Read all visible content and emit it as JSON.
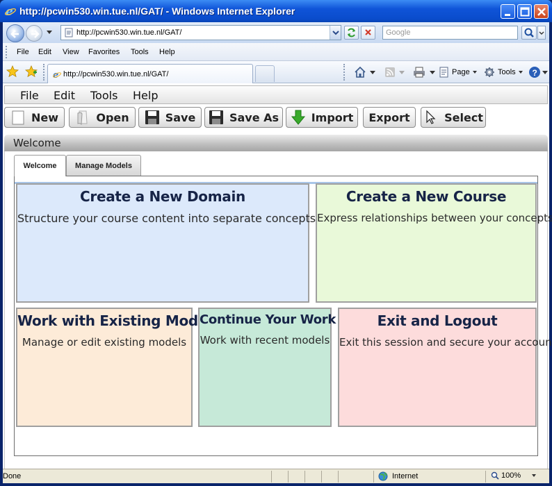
{
  "window": {
    "title": "http://pcwin530.win.tue.nl/GAT/ - Windows Internet Explorer"
  },
  "browser": {
    "address": "http://pcwin530.win.tue.nl/GAT/",
    "search_placeholder": "Google",
    "menu": [
      "File",
      "Edit",
      "View",
      "Favorites",
      "Tools",
      "Help"
    ],
    "tab_title": "http://pcwin530.win.tue.nl/GAT/",
    "commands": {
      "page": "Page",
      "tools": "Tools"
    },
    "status": "Done",
    "zone": "Internet",
    "zoom": "100%"
  },
  "app": {
    "menu": [
      "File",
      "Edit",
      "Tools",
      "Help"
    ],
    "toolbar": {
      "new": "New",
      "open": "Open",
      "save": "Save",
      "save_as": "Save As",
      "import": "Import",
      "export": "Export",
      "select": "Select"
    },
    "panel_title": "Welcome",
    "tabs": [
      "Welcome",
      "Manage Models"
    ],
    "cards": [
      {
        "title": "Create a New Domain",
        "desc": "Structure your course content into separate concepts",
        "color": "#dce9fb"
      },
      {
        "title": "Create a New Course",
        "desc": "Express relationships between your concepts",
        "color": "#e9f9d9"
      },
      {
        "title": "Work with Existing Models",
        "desc": "Manage or edit existing models",
        "color": "#fdebd8"
      },
      {
        "title": "Continue Your Work",
        "desc": "Work with recent models",
        "color": "#c6e9d8"
      },
      {
        "title": "Exit and Logout",
        "desc": "Exit this session and secure your account",
        "color": "#fddcdc"
      }
    ]
  }
}
